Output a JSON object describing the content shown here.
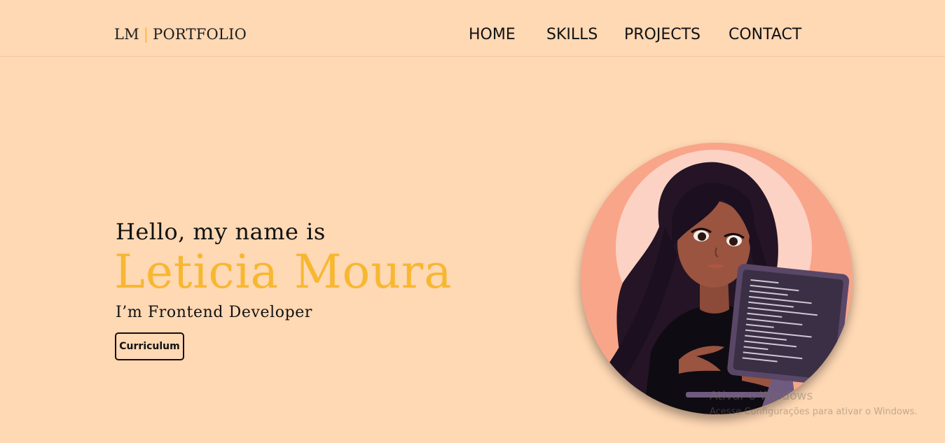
{
  "header": {
    "logo": {
      "initials": "LM",
      "separator": "|",
      "word": "PORTFOLIO"
    },
    "nav": [
      {
        "label": "HOME"
      },
      {
        "label": "SKILLS"
      },
      {
        "label": "PROJECTS"
      },
      {
        "label": "CONTACT"
      }
    ]
  },
  "hero": {
    "greeting": "Hello, my name is",
    "name": "Leticia Moura",
    "role": "I’m Frontend Developer",
    "cv_button": "Curriculum"
  },
  "avatar": {
    "icon": "girl-with-computer-illustration"
  },
  "watermark": {
    "title": "Ativar o Windows",
    "subtitle": "Acesse Configurações para ativar o Windows."
  },
  "colors": {
    "background": "#ffd8b4",
    "accent": "#f7b731",
    "text": "#111111",
    "avatar_ring": "#f9a58a"
  }
}
